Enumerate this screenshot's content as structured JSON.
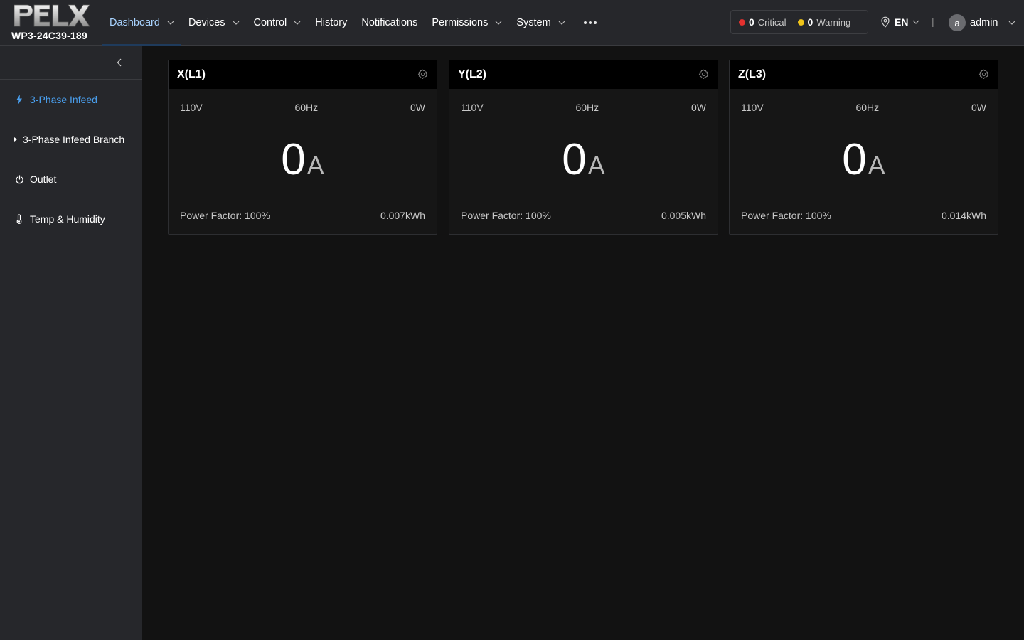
{
  "header": {
    "device_id": "WP3-24C39-189",
    "nav": [
      {
        "label": "Dashboard",
        "dropdown": true,
        "active": true
      },
      {
        "label": "Devices",
        "dropdown": true
      },
      {
        "label": "Control",
        "dropdown": true
      },
      {
        "label": "History",
        "dropdown": false
      },
      {
        "label": "Notifications",
        "dropdown": false
      },
      {
        "label": "Permissions",
        "dropdown": true
      },
      {
        "label": "System",
        "dropdown": true
      }
    ],
    "alarms": {
      "critical": {
        "count": "0",
        "label": "Critical",
        "color": "#e5312f"
      },
      "warning": {
        "count": "0",
        "label": "Warning",
        "color": "#f0c419"
      }
    },
    "language": "EN",
    "separator": "|",
    "user": {
      "initial": "a",
      "name": "admin"
    }
  },
  "sidebar": {
    "items": [
      {
        "label": "3-Phase Infeed",
        "icon": "bolt-icon",
        "active": true
      },
      {
        "label": "3-Phase Infeed Branch",
        "icon": "caret-right-icon"
      },
      {
        "label": "Outlet",
        "icon": "power-icon"
      },
      {
        "label": "Temp & Humidity",
        "icon": "thermometer-icon"
      }
    ]
  },
  "phases": [
    {
      "title": "X(L1)",
      "voltage": "110V",
      "frequency": "60Hz",
      "power": "0W",
      "current": "0",
      "unit": "A",
      "power_factor": "Power Factor: 100%",
      "energy": "0.007kWh"
    },
    {
      "title": "Y(L2)",
      "voltage": "110V",
      "frequency": "60Hz",
      "power": "0W",
      "current": "0",
      "unit": "A",
      "power_factor": "Power Factor: 100%",
      "energy": "0.005kWh"
    },
    {
      "title": "Z(L3)",
      "voltage": "110V",
      "frequency": "60Hz",
      "power": "0W",
      "current": "0",
      "unit": "A",
      "power_factor": "Power Factor: 100%",
      "energy": "0.014kWh"
    }
  ]
}
